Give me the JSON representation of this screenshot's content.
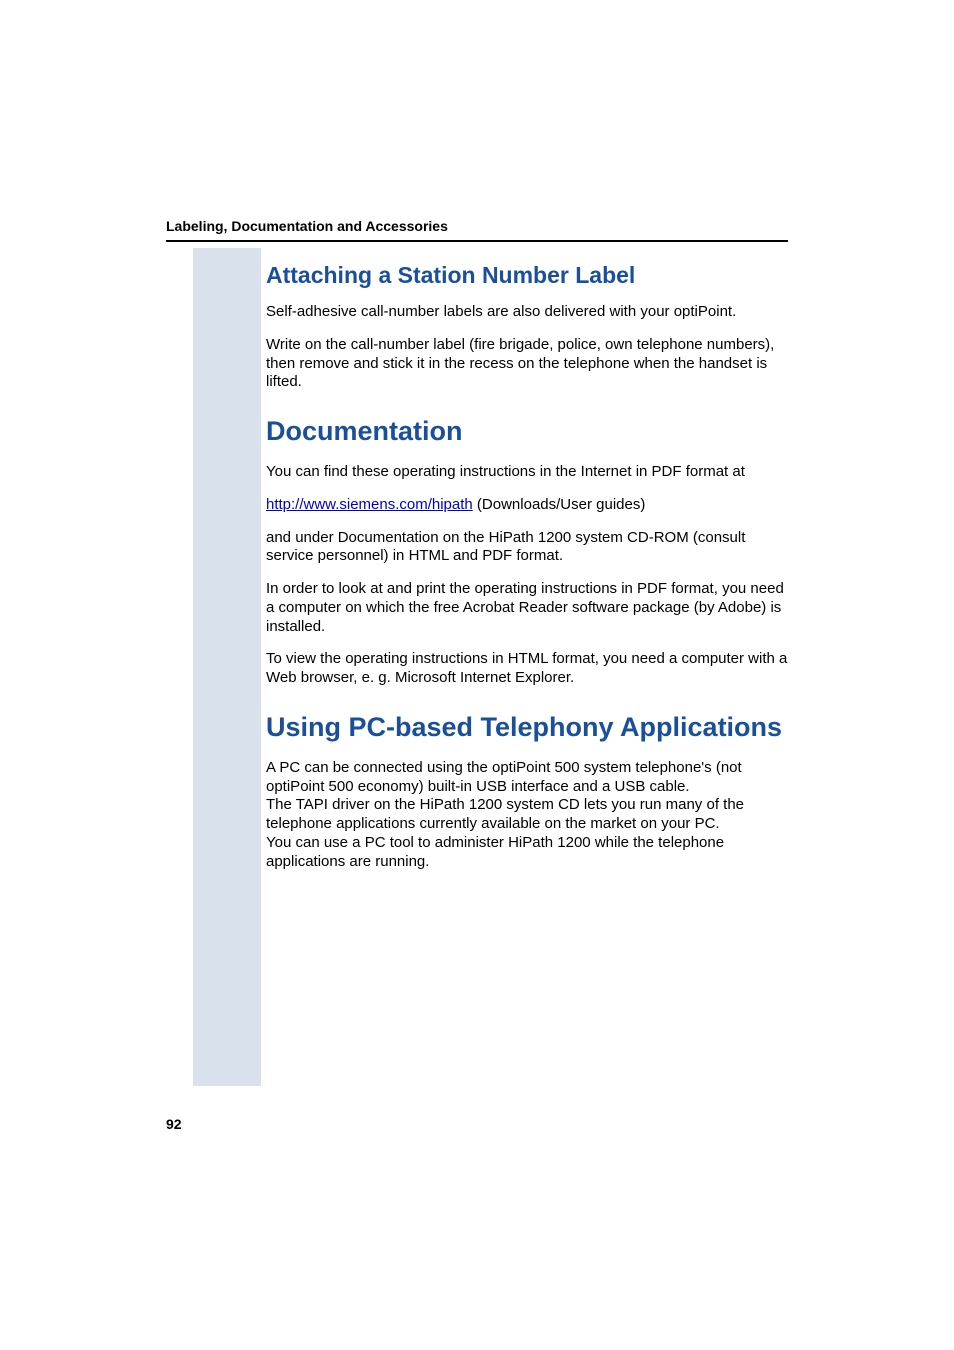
{
  "header": {
    "running": "Labeling, Documentation and Accessories"
  },
  "sections": {
    "attaching": {
      "title": "Attaching a Station Number Label",
      "p1": "Self-adhesive call-number labels are also delivered with your optiPoint.",
      "p2": "Write on the call-number label (fire brigade, police, own telephone numbers), then remove and stick it in the recess on the telephone when the handset is lifted."
    },
    "documentation": {
      "title": "Documentation",
      "p1": "You can find these operating instructions in the Internet in PDF format at",
      "link_text": "http://www.siemens.com/hipath",
      "link_suffix": " (Downloads/User guides)",
      "p3": "and under Documentation on the HiPath 1200 system CD-ROM (consult service personnel) in HTML and PDF format.",
      "p4": "In order to look at and print the operating instructions in PDF format, you need a computer on which the free Acrobat Reader software package (by Adobe) is installed.",
      "p5": "To view the operating instructions in HTML format, you need a computer with a Web browser, e. g. Microsoft Internet Explorer."
    },
    "pc_apps": {
      "title": "Using PC-based Telephony Applications",
      "p1": "A PC can be connected using the optiPoint 500 system telephone's (not optiPoint 500 economy) built-in USB interface and a USB cable.\nThe TAPI driver on the HiPath 1200 system CD lets you run many of the telephone applications currently available on the market on your PC.\nYou can use a PC tool to administer HiPath 1200 while the telephone applications are running."
    }
  },
  "page_number": "92"
}
